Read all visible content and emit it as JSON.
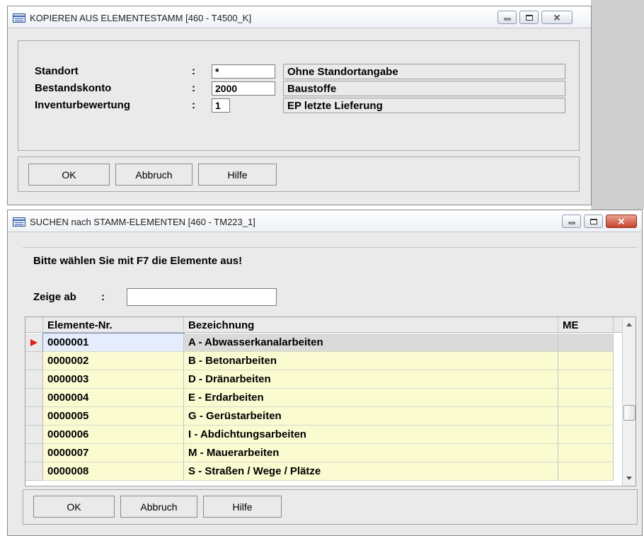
{
  "window1": {
    "title": "KOPIEREN AUS ELEMENTESTAMM  [460 - T4500_K]",
    "fields": [
      {
        "label": "Standort",
        "sep": ":",
        "value": "*",
        "desc": "Ohne Standortangabe"
      },
      {
        "label": "Bestandskonto",
        "sep": ":",
        "value": "2000",
        "desc": "Baustoffe"
      },
      {
        "label": "Inventurbewertung",
        "sep": ":",
        "value": "1",
        "desc": "EP letzte Lieferung"
      }
    ],
    "buttons": {
      "ok": "OK",
      "cancel": "Abbruch",
      "help": "Hilfe"
    }
  },
  "window2": {
    "title": "SUCHEN nach STAMM-ELEMENTEN  [460 - TM223_1]",
    "instruction": "Bitte wählen Sie mit F7 die Elemente aus!",
    "show_from": {
      "label": "Zeige ab",
      "sep": ":",
      "value": ""
    },
    "table": {
      "columns": [
        "Elemente-Nr.",
        "Bezeichnung",
        "ME"
      ],
      "rows": [
        {
          "nr": "0000001",
          "name": "A - Abwasserkanalarbeiten",
          "me": ""
        },
        {
          "nr": "0000002",
          "name": "B - Betonarbeiten",
          "me": ""
        },
        {
          "nr": "0000003",
          "name": "D - Dränarbeiten",
          "me": ""
        },
        {
          "nr": "0000004",
          "name": "E - Erdarbeiten",
          "me": ""
        },
        {
          "nr": "0000005",
          "name": "G - Gerüstarbeiten",
          "me": ""
        },
        {
          "nr": "0000006",
          "name": "I - Abdichtungsarbeiten",
          "me": ""
        },
        {
          "nr": "0000007",
          "name": "M - Mauerarbeiten",
          "me": ""
        },
        {
          "nr": "0000008",
          "name": "S - Straßen / Wege / Plätze",
          "me": ""
        }
      ],
      "selected_row": 0
    },
    "buttons": {
      "ok": "OK",
      "cancel": "Abbruch",
      "help": "Hilfe"
    }
  },
  "colors": {
    "row_bg": "#fbfbd2",
    "selected_row_bg": "#dadada",
    "selected_cell_bg": "#e5ecfb",
    "row_indicator": "#e51b1b",
    "close_button": "#c6442b"
  }
}
